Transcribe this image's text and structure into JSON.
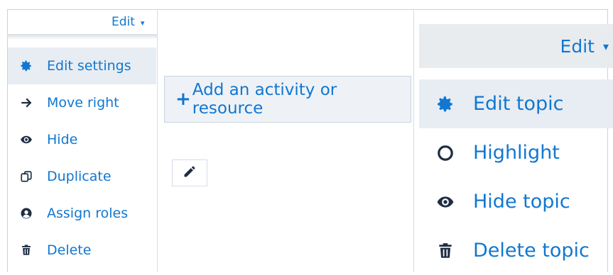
{
  "small_dropdown": {
    "label": "Edit",
    "caret": "▾",
    "items": [
      {
        "label": "Edit settings",
        "icon": "gear-icon",
        "active": true
      },
      {
        "label": "Move right",
        "icon": "arrow-right-icon",
        "active": false
      },
      {
        "label": "Hide",
        "icon": "eye-icon",
        "active": false
      },
      {
        "label": "Duplicate",
        "icon": "duplicate-icon",
        "active": false
      },
      {
        "label": "Assign roles",
        "icon": "user-circle-icon",
        "active": false
      },
      {
        "label": "Delete",
        "icon": "trash-icon",
        "active": false
      }
    ]
  },
  "activity": {
    "plus": "+",
    "add_label": "Add an activity or resource",
    "edit_icon": "pencil-icon"
  },
  "big_dropdown": {
    "label": "Edit",
    "caret": "▾",
    "items": [
      {
        "label": "Edit topic",
        "icon": "gear-icon",
        "active": true
      },
      {
        "label": "Highlight",
        "icon": "circle-outline-icon",
        "active": false
      },
      {
        "label": "Hide topic",
        "icon": "eye-icon",
        "active": false
      },
      {
        "label": "Delete topic",
        "icon": "trash-icon",
        "active": false
      }
    ]
  },
  "colors": {
    "link": "#1177d1",
    "dark_icon": "#1f2d44",
    "active_bg": "#e8edf3"
  }
}
